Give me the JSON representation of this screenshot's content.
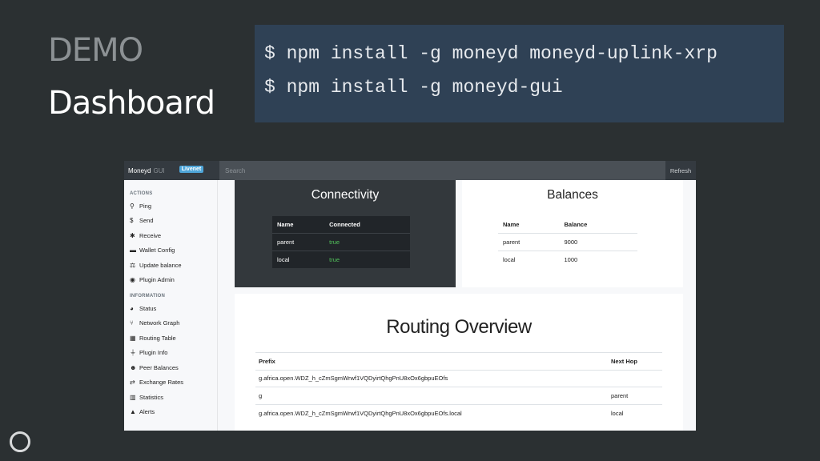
{
  "slide": {
    "title_line1": "DEMO",
    "title_line2": "Dashboard",
    "code": [
      "$ npm install -g moneyd moneyd-uplink-xrp",
      "$ npm install -g moneyd-gui"
    ]
  },
  "app": {
    "brand": "Moneyd",
    "brand_suffix": "GUI",
    "network_badge": "Livenet",
    "search_placeholder": "Search",
    "refresh_label": "Refresh",
    "sidebar": {
      "actions_heading": "ACTIONS",
      "actions": [
        {
          "icon": "pin-icon",
          "glyph": "⚲",
          "label": "Ping"
        },
        {
          "icon": "dollar-icon",
          "glyph": "$",
          "label": "Send"
        },
        {
          "icon": "receive-icon",
          "glyph": "✱",
          "label": "Receive"
        },
        {
          "icon": "wallet-icon",
          "glyph": "▬",
          "label": "Wallet Config"
        },
        {
          "icon": "balance-icon",
          "glyph": "⚖",
          "label": "Update balance"
        },
        {
          "icon": "eye-icon",
          "glyph": "◉",
          "label": "Plugin Admin"
        }
      ],
      "information_heading": "INFORMATION",
      "information": [
        {
          "icon": "pie-chart-icon",
          "glyph": "◕",
          "label": "Status"
        },
        {
          "icon": "branch-icon",
          "glyph": "⑂",
          "label": "Network Graph"
        },
        {
          "icon": "routing-icon",
          "glyph": "▦",
          "label": "Routing Table"
        },
        {
          "icon": "plug-icon",
          "glyph": "⏚",
          "label": "Plugin Info"
        },
        {
          "icon": "users-icon",
          "glyph": "☻",
          "label": "Peer Balances"
        },
        {
          "icon": "exchange-icon",
          "glyph": "⇄",
          "label": "Exchange Rates"
        },
        {
          "icon": "bar-chart-icon",
          "glyph": "▥",
          "label": "Statistics"
        },
        {
          "icon": "warning-icon",
          "glyph": "▲",
          "label": "Alerts"
        }
      ]
    },
    "connectivity": {
      "title": "Connectivity",
      "headers": [
        "Name",
        "Connected"
      ],
      "rows": [
        [
          "parent",
          "true"
        ],
        [
          "local",
          "true"
        ]
      ]
    },
    "balances": {
      "title": "Balances",
      "headers": [
        "Name",
        "Balance"
      ],
      "rows": [
        [
          "parent",
          "9000"
        ],
        [
          "local",
          "1000"
        ]
      ]
    },
    "routing": {
      "title": "Routing Overview",
      "headers": [
        "Prefix",
        "Next Hop"
      ],
      "rows": [
        [
          "g.africa.open.WDZ_h_cZmSgmWrwf1VQDyirtQhgPnU8xOx6gbpuEOfs",
          ""
        ],
        [
          "g",
          "parent"
        ],
        [
          "g.africa.open.WDZ_h_cZmSgmWrwf1VQDyirtQhgPnU8xOx6gbpuEOfs.local",
          "local"
        ]
      ]
    }
  }
}
